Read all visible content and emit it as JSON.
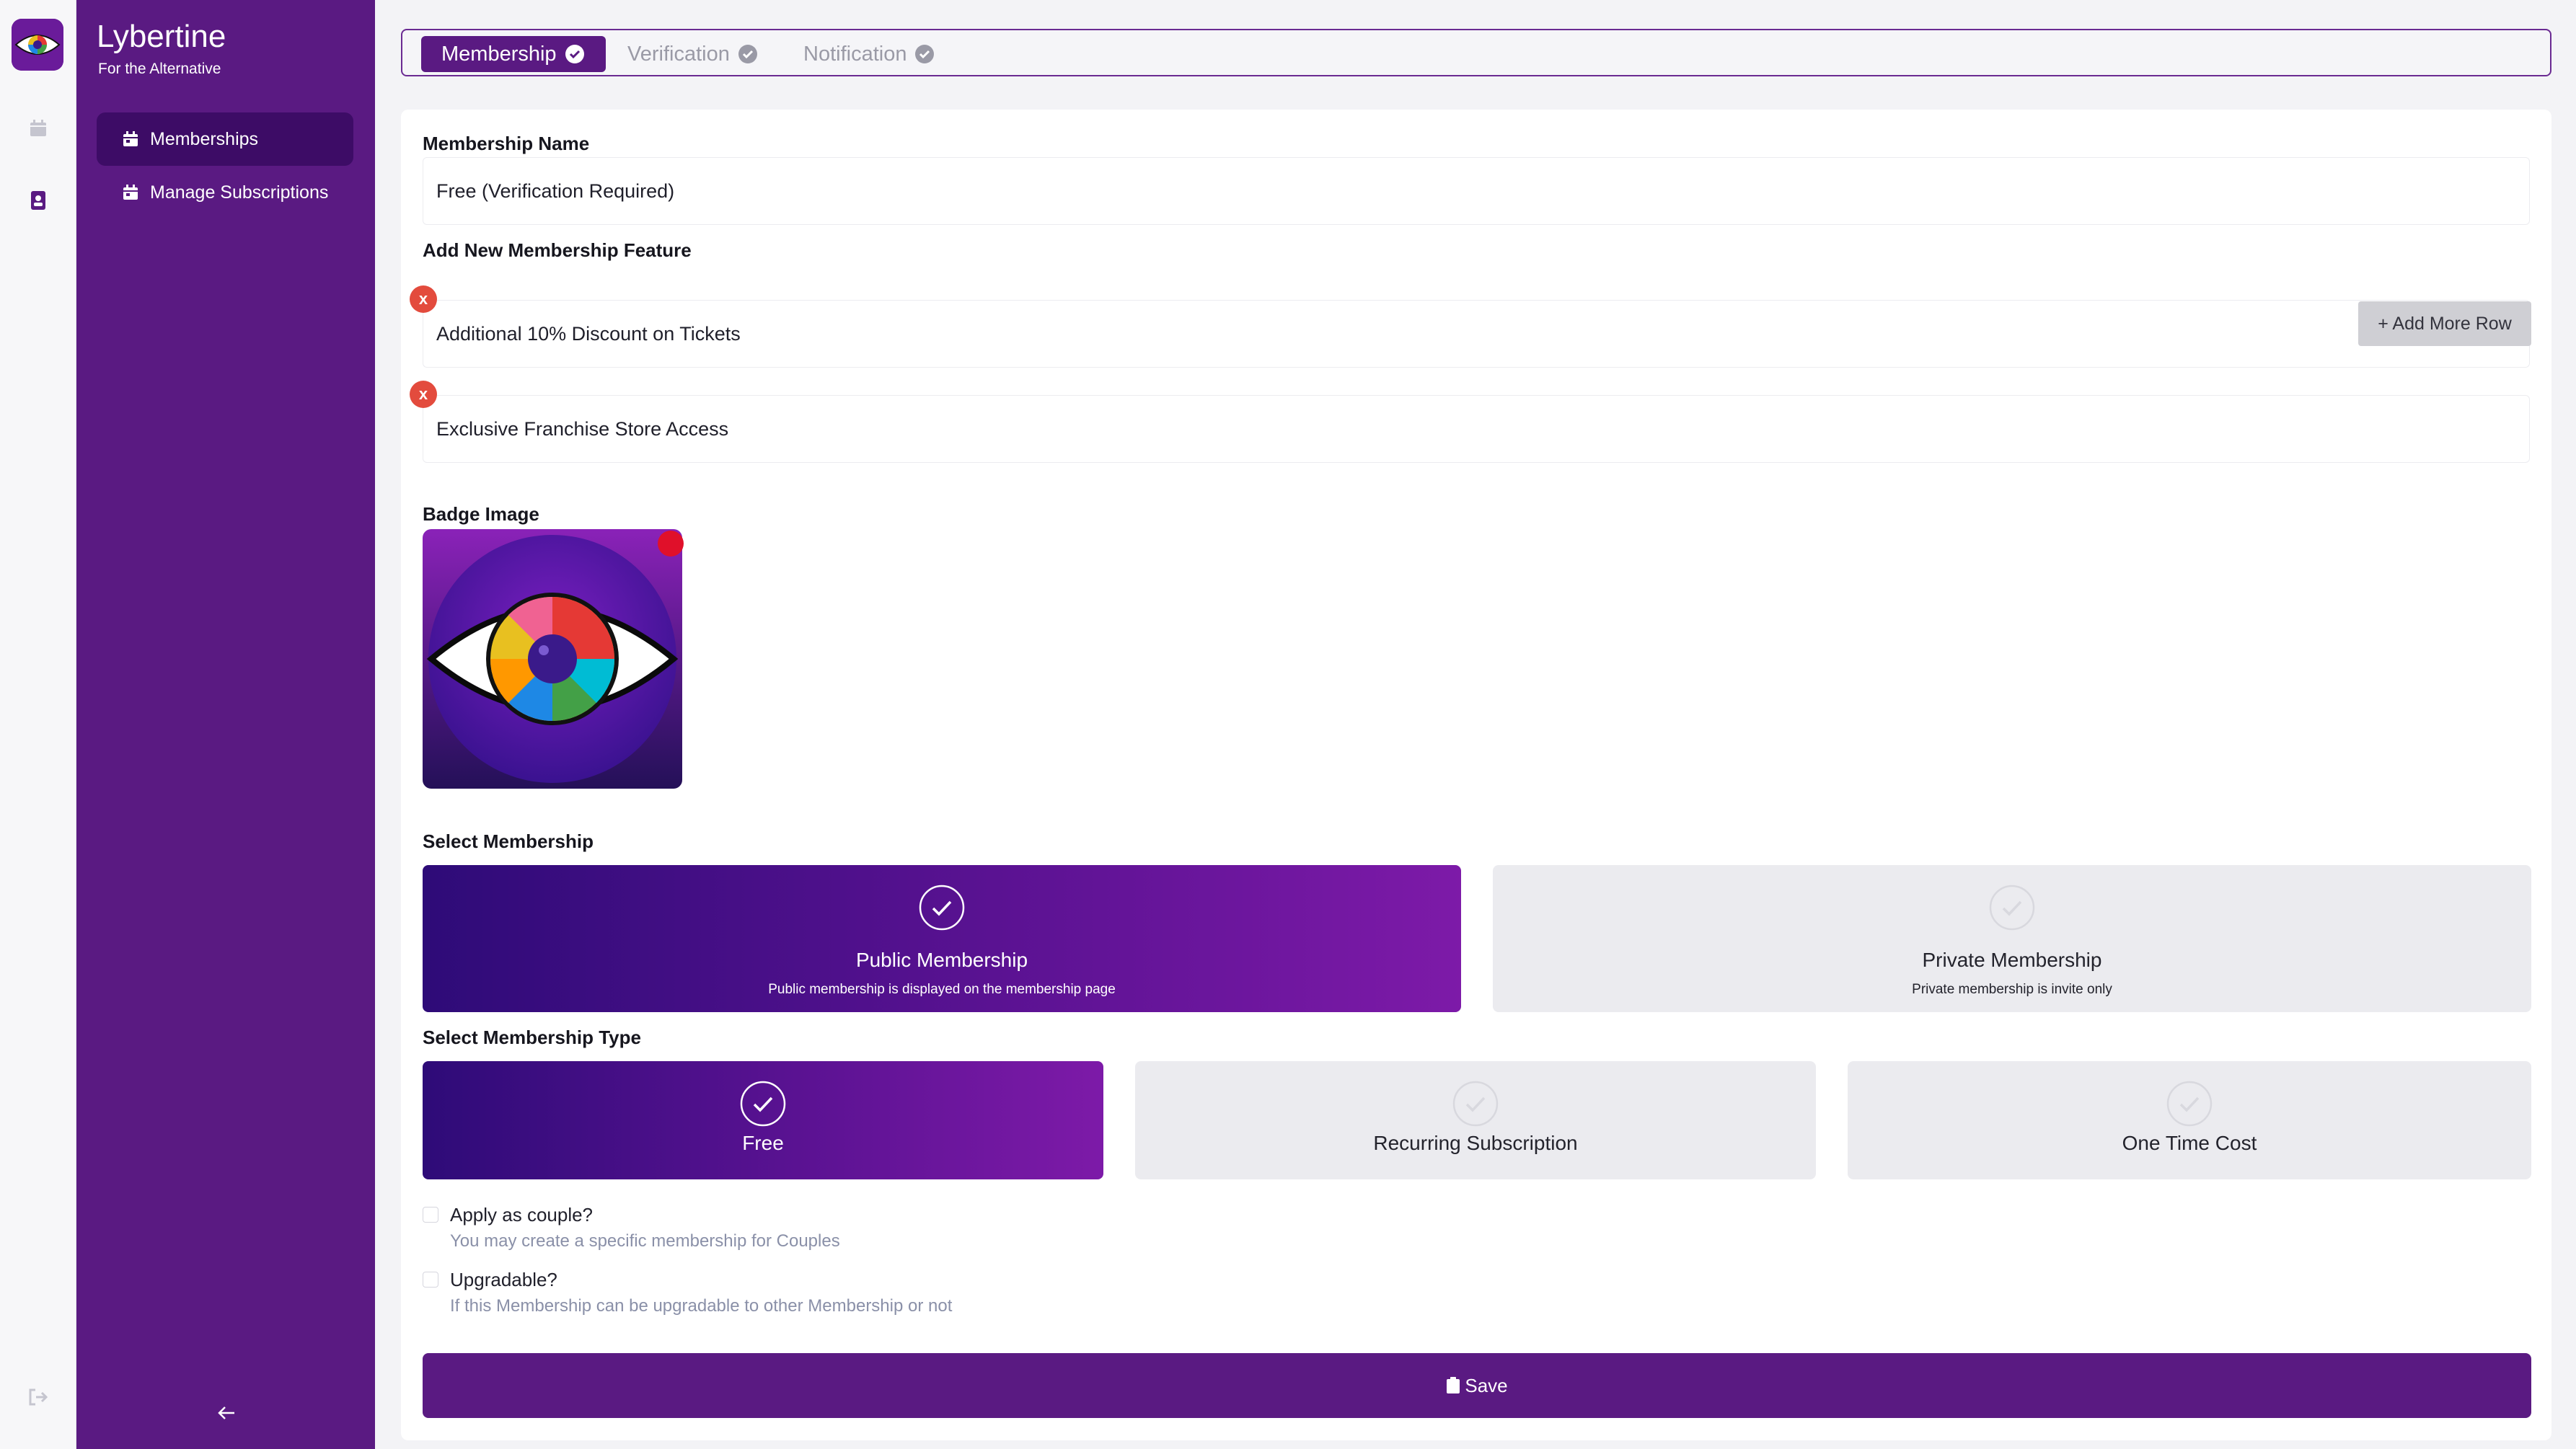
{
  "brand": {
    "title": "Lybertine",
    "subtitle": "For the Alternative"
  },
  "sidebar": {
    "items": [
      {
        "label": "Memberships",
        "active": true
      },
      {
        "label": "Manage Subscriptions",
        "active": false
      }
    ]
  },
  "stepper": {
    "steps": [
      {
        "label": "Membership",
        "state": "active"
      },
      {
        "label": "Verification",
        "state": "pending"
      },
      {
        "label": "Notification",
        "state": "pending"
      }
    ]
  },
  "form": {
    "membership_name_label": "Membership Name",
    "membership_name_value": "Free (Verification Required)",
    "features_label": "Add New Membership Feature",
    "features": [
      "Additional 10% Discount on Tickets",
      "Exclusive Franchise Store Access"
    ],
    "remove_glyph": "x",
    "add_row_label": "+ Add More Row",
    "badge_label": "Badge Image",
    "select_membership_label": "Select Membership",
    "membership_options": [
      {
        "title": "Public Membership",
        "desc": "Public membership is displayed on the membership page",
        "selected": true
      },
      {
        "title": "Private Membership",
        "desc": "Private membership is invite only",
        "selected": false
      }
    ],
    "select_type_label": "Select Membership Type",
    "type_options": [
      {
        "title": "Free",
        "selected": true
      },
      {
        "title": "Recurring Subscription",
        "selected": false
      },
      {
        "title": "One Time Cost",
        "selected": false
      }
    ],
    "couple_label": "Apply as couple?",
    "couple_hint": "You may create a specific membership for Couples",
    "upgradable_label": "Upgradable?",
    "upgradable_hint": "If this Membership can be upgradable to other Membership or not",
    "save_label": "Save"
  },
  "colors": {
    "sidebar": "#5a1a82",
    "sidebar_active": "#3d0c66",
    "remove": "#e34b3d",
    "hint": "#8a90a8"
  },
  "icons": {
    "rail": [
      "calendar-icon",
      "contact-book-icon",
      "logout-icon"
    ],
    "nav": "calendar-icon",
    "collapse": "arrow-left-icon",
    "save": "clipboard-icon"
  }
}
